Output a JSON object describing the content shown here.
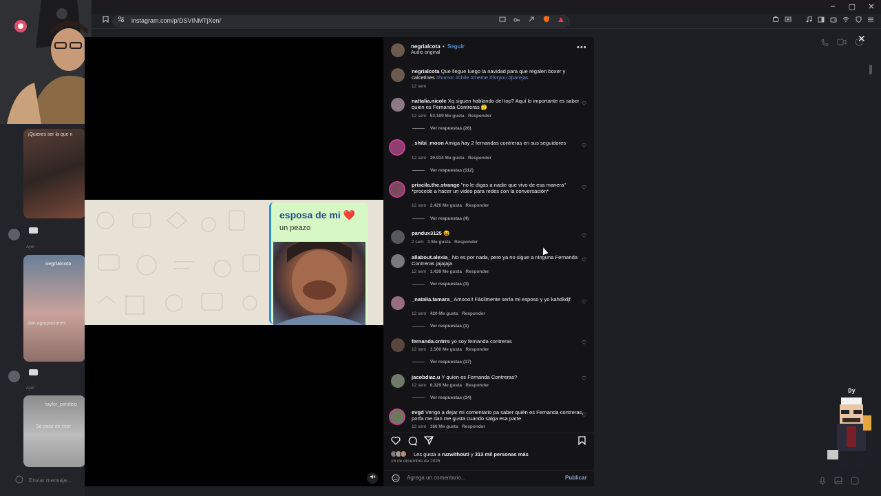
{
  "browser": {
    "url": "instagram.com/p/DSVINMTjXen/",
    "window_controls": [
      "–",
      "▢",
      "✕"
    ]
  },
  "background_app": {
    "thumb_texts": [
      "¡Quieres ser la que n",
      "negrialcota",
      "dan agrupaciones",
      "taylor_pendejo",
      "Se paso de inter"
    ],
    "time_labels": [
      "Ayer",
      "Ayer"
    ],
    "input_placeholder": "Enviar mensaje..."
  },
  "post": {
    "image": {
      "bubble_title": "esposa de mi ❤️",
      "bubble_subtitle": "un peazo"
    },
    "header": {
      "username": "negrialcota",
      "separator": "•",
      "follow_label": "Seguir",
      "audio_label": "Audio original"
    },
    "caption": {
      "username": "negrialcota",
      "text": "Que llegue luego la navidad para que regalen boxer y calcetines",
      "tags": "#humor #chile #meme #foryou #parejas",
      "time": "12 sem"
    },
    "comments": [
      {
        "username": "nattalia.nicole",
        "text": "Xq siguen hablando del top? Aquí lo importante es saber quien es Fernanda Contreras 🤔",
        "time": "12 sem",
        "likes": "53.109 Me gusta",
        "reply": "Responder",
        "replies": "Ver respuestas (26)"
      },
      {
        "username": "_shibi_moon",
        "text": "Amiga hay 2 fernandas contreras en sus seguidores",
        "time": "12 sem",
        "likes": "39.934 Me gusta",
        "reply": "Responder",
        "replies": "Ver respuestas (112)"
      },
      {
        "username": "priscila.the.strange",
        "text": "\"no le digas a nadie que vivo de esa manera\" *procede a hacer un video para redes con la conversación*",
        "time": "12 sem",
        "likes": "2.426 Me gusta",
        "reply": "Responder",
        "replies": "Ver respuestas (4)"
      },
      {
        "username": "pandux3125",
        "text": "😝",
        "time": "2 sem",
        "likes": "1 Me gusta",
        "reply": "Responder",
        "replies": ""
      },
      {
        "username": "allabout.alexia_",
        "text": "No es por nada, pero ya no sigue a ninguna Fernanda Contreras jajajaja",
        "time": "12 sem",
        "likes": "1.439 Me gusta",
        "reply": "Responder",
        "replies": "Ver respuestas (3)"
      },
      {
        "username": "_natalia.tamara_",
        "text": "Amooo!! Fácilmente sería mi esposo y yo kahdkdjf",
        "time": "12 sem",
        "likes": "420 Me gusta",
        "reply": "Responder",
        "replies": "Ver respuestas (1)"
      },
      {
        "username": "fernanda.cntrrs",
        "text": "yo soy fernanda contreras",
        "time": "12 sem",
        "likes": "1.560 Me gusta",
        "reply": "Responder",
        "replies": "Ver respuestas (17)"
      },
      {
        "username": "jacobdiaz.u",
        "text": "Y quien es Fernanda Contreras?",
        "time": "12 sem",
        "likes": "6.329 Me gusta",
        "reply": "Responder",
        "replies": "Ver respuestas (14)"
      },
      {
        "username": "evgd",
        "text": "Vengo a dejar mi comentario pa saber quién es Fernanda contreras, porfa me dan me gusta cuando salga esa parte",
        "time": "12 sem",
        "likes": "166 Me gusta",
        "reply": "Responder",
        "replies": ""
      }
    ],
    "likes_summary": {
      "prefix": "Les gusta a",
      "user": "ruzwithouti",
      "middle": "y",
      "others": "313 mil personas más"
    },
    "date": "16 de diciembre de 2025",
    "add_comment_placeholder": "Agrega un comentario...",
    "publish_label": "Publicar"
  },
  "overlay": {
    "mascot_tag": "Dy"
  },
  "colors": {
    "accent_blue": "#4a90e2",
    "panel_bg": "#141416",
    "bubble_bg": "#d7f7c4"
  }
}
